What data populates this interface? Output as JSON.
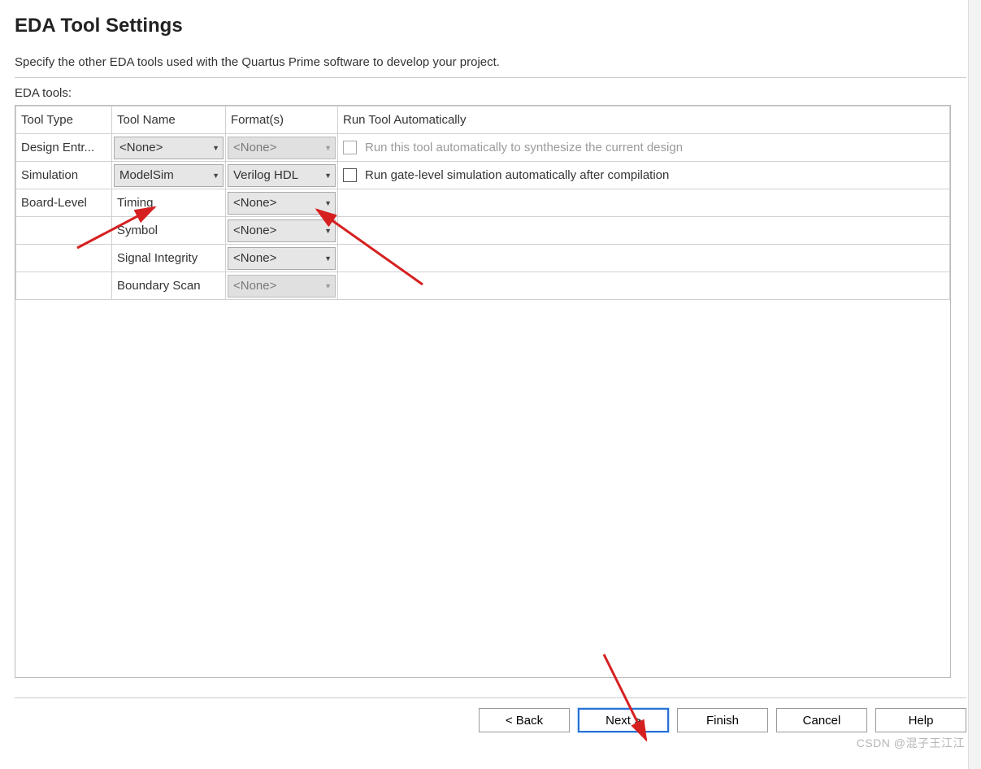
{
  "header": {
    "title": "EDA Tool Settings",
    "subtitle": "Specify the other EDA tools used with the Quartus Prime software to develop your project."
  },
  "eda_label": "EDA tools:",
  "columns": {
    "tooltype": "Tool Type",
    "toolname": "Tool Name",
    "formats": "Format(s)",
    "runauto": "Run Tool Automatically"
  },
  "rows": [
    {
      "tooltype": "Design Entr...",
      "toolname": "<None>",
      "toolname_enabled": true,
      "format": "<None>",
      "format_enabled": false,
      "auto_label": "Run this tool automatically to synthesize the current design",
      "auto_enabled": false
    },
    {
      "tooltype": "Simulation",
      "toolname": "ModelSim",
      "toolname_enabled": true,
      "format": "Verilog HDL",
      "format_enabled": true,
      "auto_label": "Run gate-level simulation automatically after compilation",
      "auto_enabled": true
    },
    {
      "tooltype": "Board-Level",
      "toolname": "Timing",
      "toolname_enabled": null,
      "format": "<None>",
      "format_enabled": true,
      "auto_label": "",
      "auto_enabled": null
    },
    {
      "tooltype": "",
      "toolname": "Symbol",
      "toolname_enabled": null,
      "format": "<None>",
      "format_enabled": true,
      "auto_label": "",
      "auto_enabled": null
    },
    {
      "tooltype": "",
      "toolname": "Signal Integrity",
      "toolname_enabled": null,
      "format": "<None>",
      "format_enabled": true,
      "auto_label": "",
      "auto_enabled": null
    },
    {
      "tooltype": "",
      "toolname": "Boundary Scan",
      "toolname_enabled": null,
      "format": "<None>",
      "format_enabled": false,
      "auto_label": "",
      "auto_enabled": null
    }
  ],
  "buttons": {
    "back": "< Back",
    "next": "Next >",
    "finish": "Finish",
    "cancel": "Cancel",
    "help": "Help"
  },
  "watermark": "CSDN @混子王江江"
}
